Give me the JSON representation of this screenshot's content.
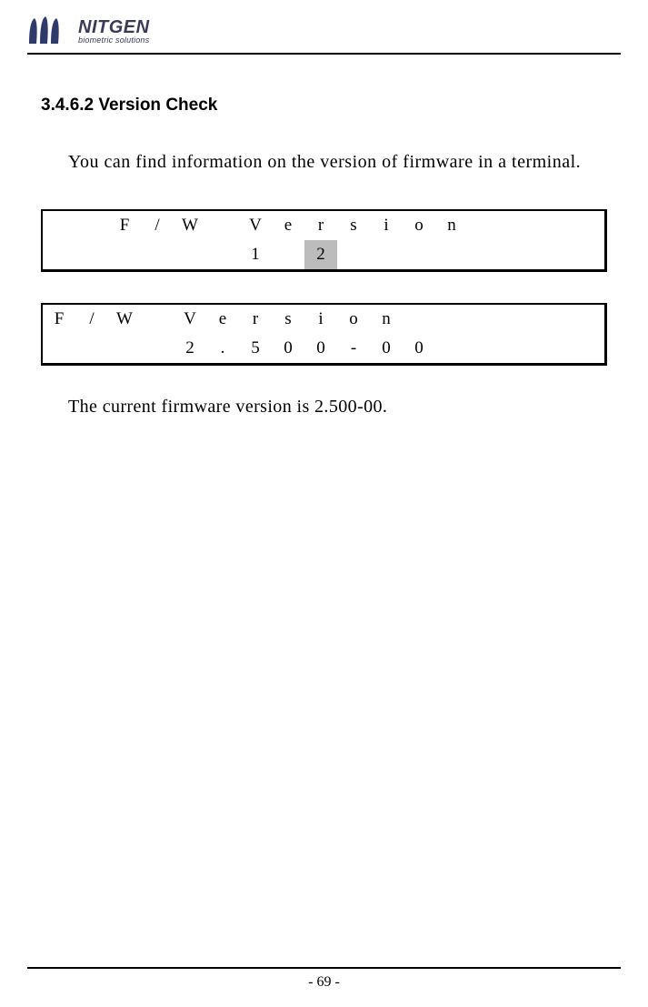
{
  "logo": {
    "brand": "NITGEN",
    "tagline": "biometric solutions"
  },
  "section": {
    "number": "3.4.6.2",
    "title": "Version Check"
  },
  "intro_text": "You can find information on the version of firmware in a terminal.",
  "lcd1": {
    "row1": [
      "",
      "",
      "F",
      "/",
      "W",
      "",
      "V",
      "e",
      "r",
      "s",
      "i",
      "o",
      "n",
      "",
      "",
      ""
    ],
    "row2": [
      "",
      "",
      "",
      "",
      "",
      "",
      "1",
      "",
      "2",
      "",
      "",
      "",
      "",
      "",
      "",
      ""
    ],
    "highlight": {
      "row": 1,
      "col": 8
    }
  },
  "lcd2": {
    "row1": [
      "F",
      "/",
      "W",
      "",
      "V",
      "e",
      "r",
      "s",
      "i",
      "o",
      "n",
      "",
      "",
      "",
      "",
      ""
    ],
    "row2": [
      "",
      "",
      "",
      "",
      "2",
      ".",
      "5",
      "0",
      "0",
      "-",
      "0",
      "0",
      "",
      "",
      "",
      ""
    ]
  },
  "closing_text": "The current firmware version is 2.500-00.",
  "page_number": "- 69 -"
}
